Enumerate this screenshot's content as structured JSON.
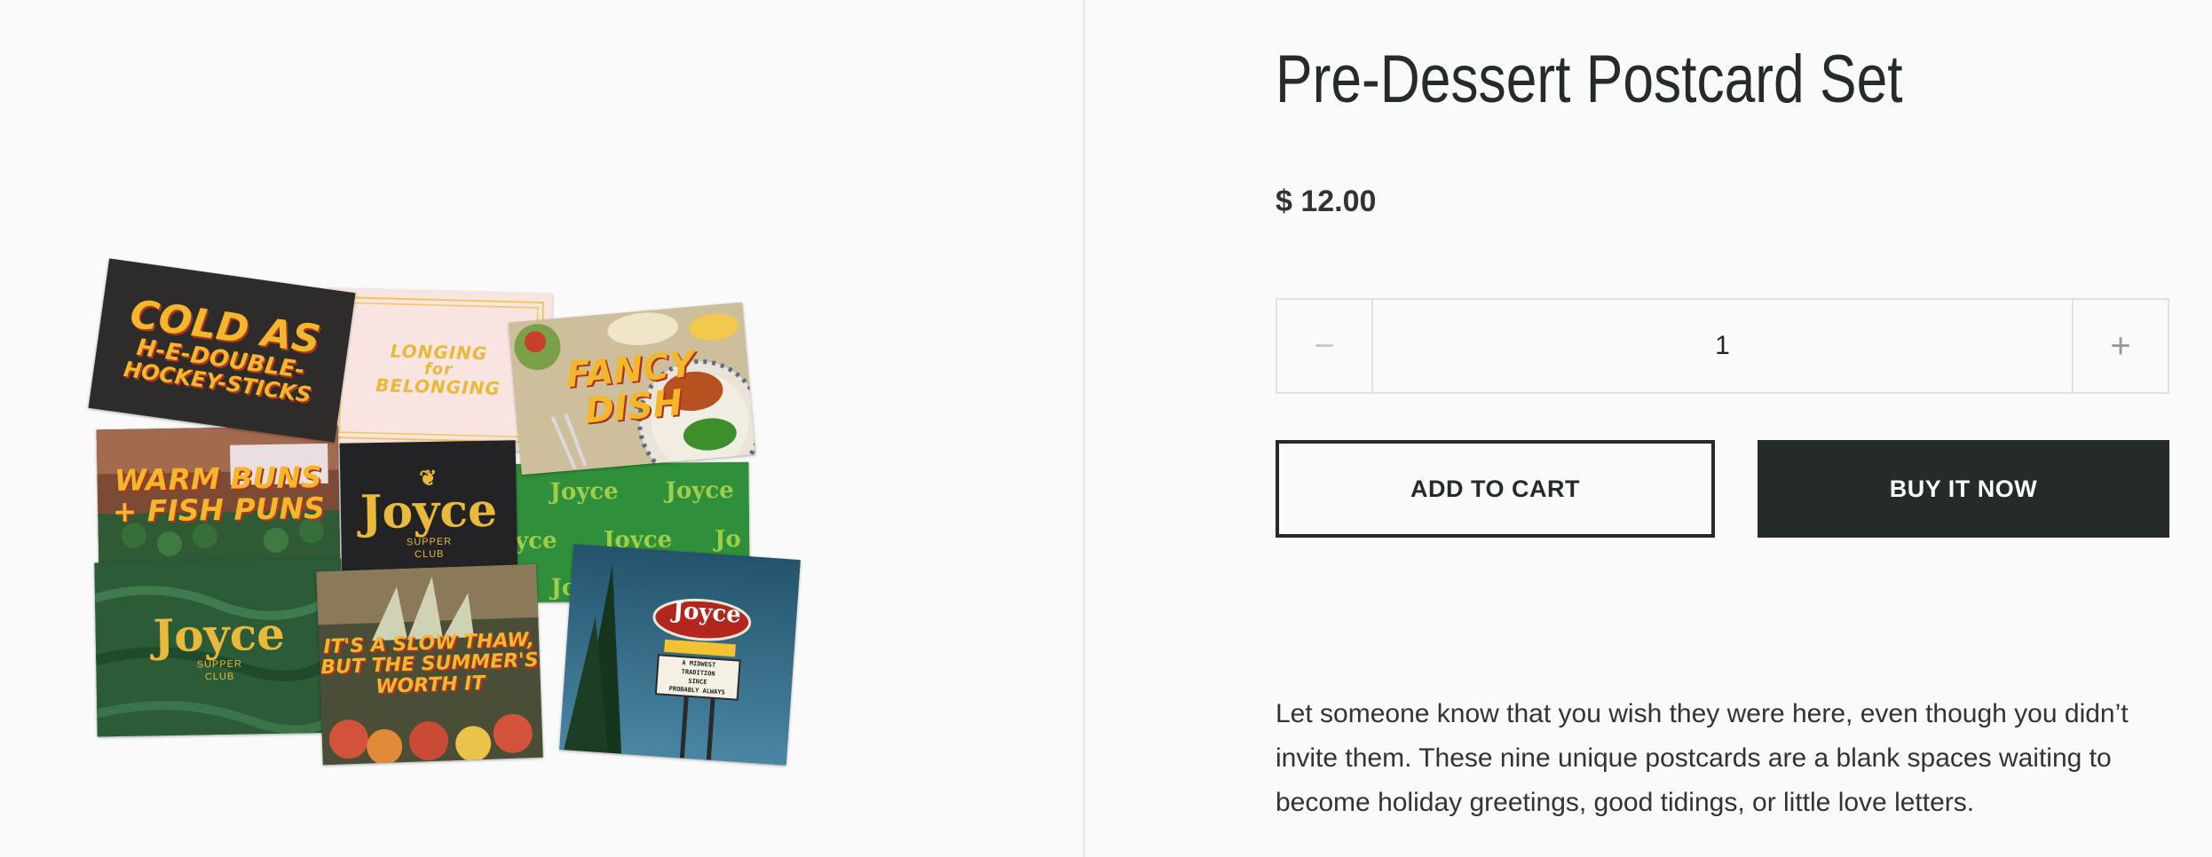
{
  "product": {
    "title": "Pre-Dessert Postcard Set",
    "price": "$ 12.00",
    "quantity": "1",
    "decrease_symbol": "−",
    "increase_symbol": "+",
    "add_to_cart_label": "ADD TO CART",
    "buy_now_label": "BUY IT NOW",
    "description": "Let someone know that you wish they were here, even though you didn’t invite them. These nine unique postcards are a blank spaces waiting to become holiday greetings, good tidings, or little love letters."
  },
  "image": {
    "cards": {
      "cold": [
        "COLD AS",
        "H-E-DOUBLE-",
        "HOCKEY-STICKS"
      ],
      "longing": [
        "LONGING",
        "for",
        "BELONGING"
      ],
      "fancy": [
        "FANCY",
        "DISH"
      ],
      "warm": [
        "WARM BUNS",
        "+ FISH PUNS"
      ],
      "joyce_logo": "Joyce",
      "supper_club": [
        "SUPPER",
        "CLUB"
      ],
      "slow": [
        "IT'S A SLOW THAW,",
        "BUT THE SUMMER'S",
        "WORTH IT"
      ],
      "sign": [
        "A MIDWEST",
        "TRADITION",
        "SINCE",
        "PROBABLY ALWAYS"
      ]
    }
  },
  "colors": {
    "accent_dark": "#252a2b",
    "card_yellow": "#f4b62a",
    "background": "#fafafa"
  }
}
